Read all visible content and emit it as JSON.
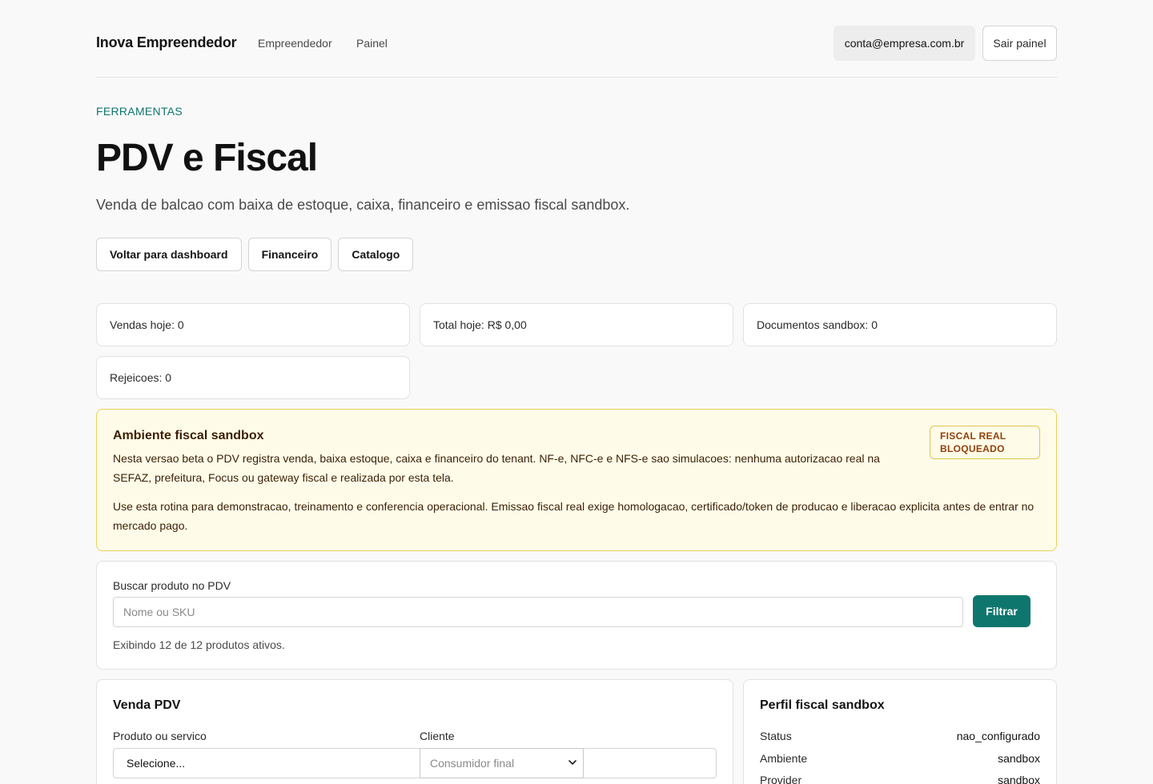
{
  "header": {
    "brand": "Inova Empreendedor",
    "nav": [
      "Empreendedor",
      "Painel"
    ],
    "account_email": "conta@empresa.com.br",
    "logout_label": "Sair painel"
  },
  "page": {
    "eyebrow": "FERRAMENTAS",
    "title": "PDV e Fiscal",
    "subtitle": "Venda de balcao com baixa de estoque, caixa, financeiro e emissao fiscal sandbox.",
    "actions": [
      "Voltar para dashboard",
      "Financeiro",
      "Catalogo"
    ]
  },
  "stats": [
    "Vendas hoje: 0",
    "Total hoje: R$ 0,00",
    "Documentos sandbox: 0",
    "Rejeicoes: 0"
  ],
  "notice": {
    "title": "Ambiente fiscal sandbox",
    "badge": "FISCAL REAL BLOQUEADO",
    "p1": "Nesta versao beta o PDV registra venda, baixa estoque, caixa e financeiro do tenant. NF-e, NFC-e e NFS-e sao simulacoes: nenhuma autorizacao real na SEFAZ, prefeitura, Focus ou gateway fiscal e realizada por esta tela.",
    "p2": "Use esta rotina para demonstracao, treinamento e conferencia operacional. Emissao fiscal real exige homologacao, certificado/token de producao e liberacao explicita antes de entrar no mercado pago."
  },
  "search": {
    "label": "Buscar produto no PDV",
    "placeholder": "Nome ou SKU",
    "button": "Filtrar",
    "meta": "Exibindo 12 de 12 produtos ativos."
  },
  "sale": {
    "title": "Venda PDV",
    "product_label": "Produto ou servico",
    "product_value": "Selecione...",
    "client_label": "Cliente",
    "client_value": "Consumidor final"
  },
  "fiscal_profile": {
    "title": "Perfil fiscal sandbox",
    "rows": [
      {
        "key": "Status",
        "value": "nao_configurado"
      },
      {
        "key": "Ambiente",
        "value": "sandbox"
      },
      {
        "key": "Provider",
        "value": "sandbox"
      }
    ]
  },
  "colors": {
    "accent": "#0f766e",
    "notice_bg": "#fefce8",
    "notice_border": "#e7d35a",
    "badge_text": "#92400e"
  },
  "icons": {
    "select_arrow": "chevron-down-icon"
  }
}
